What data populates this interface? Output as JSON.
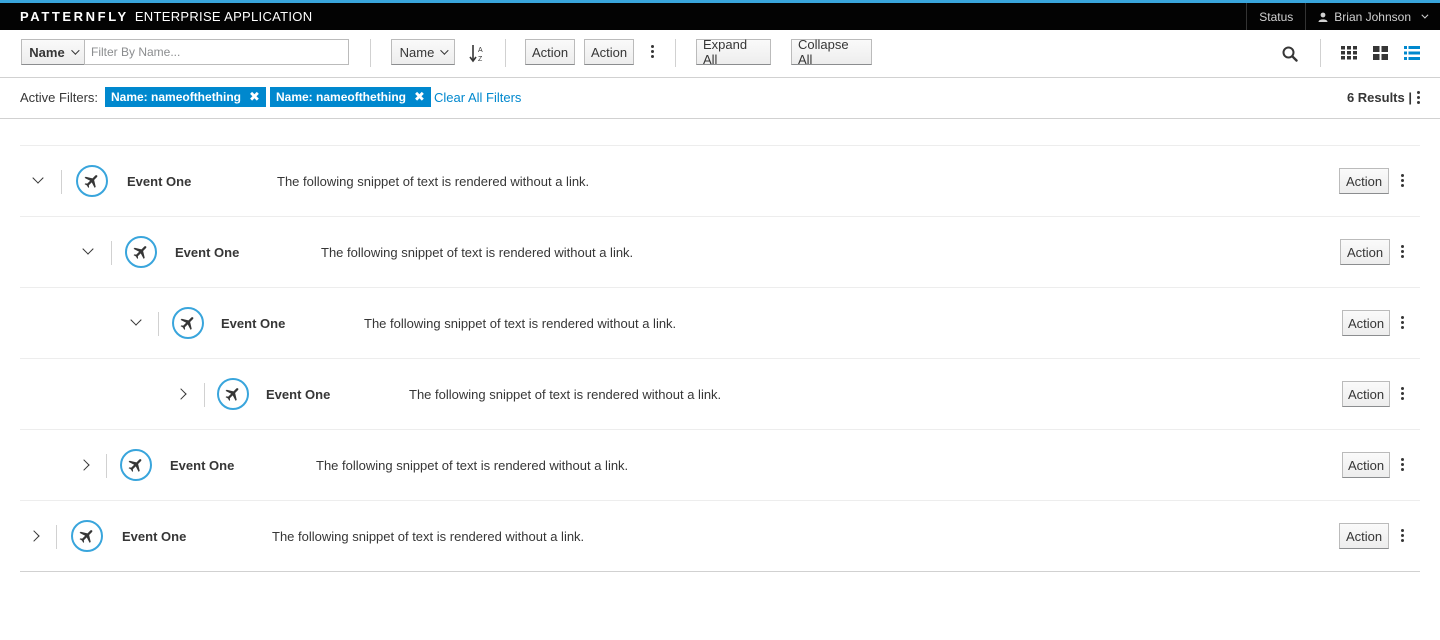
{
  "masthead": {
    "brand_strong": "PATTERNFLY",
    "brand_rest": "ENTERPRISE APPLICATION",
    "status": "Status",
    "user": "Brian Johnson",
    "accent": "#39a5dc"
  },
  "toolbar": {
    "filter_field": "Name",
    "filter_placeholder": "Filter By Name...",
    "sort_field": "Name",
    "action1": "Action",
    "action2": "Action",
    "expand_all": "Expand All",
    "collapse_all": "Collapse All",
    "icons": [
      "sort-alpha-icon",
      "kebab-icon",
      "search-icon",
      "card-view-icon",
      "small-card-view-icon",
      "list-view-icon"
    ]
  },
  "filters": {
    "label": "Active Filters:",
    "chips": [
      {
        "label": "Name: nameofthething"
      },
      {
        "label": "Name: nameofthething"
      }
    ],
    "clear_all": "Clear All Filters",
    "results": "6 Results |",
    "chip_color": "#0088ce"
  },
  "list": {
    "rows": [
      {
        "name": "Event One",
        "text": "The following snippet of text is rendered without a link.",
        "action": "Action",
        "expanded": true
      },
      {
        "name": "Event One",
        "text": "The following snippet of text is rendered without a link.",
        "action": "Action",
        "expanded": true
      },
      {
        "name": "Event One",
        "text": "The following snippet of text is rendered without a link.",
        "action": "Action",
        "expanded": true
      },
      {
        "name": "Event One",
        "text": "The following snippet of text is rendered without a link.",
        "action": "Action",
        "expanded": false
      },
      {
        "name": "Event One",
        "text": "The following snippet of text is rendered without a link.",
        "action": "Action",
        "expanded": false
      },
      {
        "name": "Event One",
        "text": "The following snippet of text is rendered without a link.",
        "action": "Action",
        "expanded": false
      }
    ]
  }
}
